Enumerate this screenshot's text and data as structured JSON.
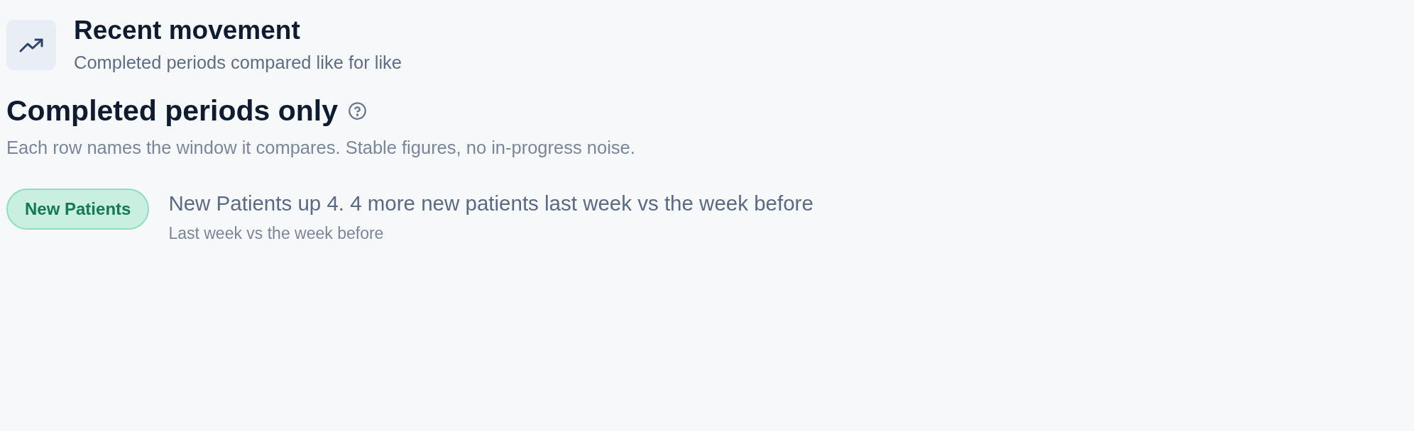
{
  "header": {
    "title": "Recent movement",
    "subtitle": "Completed periods compared like for like"
  },
  "section": {
    "title": "Completed periods only",
    "description": "Each row names the window it compares. Stable figures, no in-progress noise."
  },
  "rows": [
    {
      "tag": "New Patients",
      "summary": "New Patients up 4. 4 more new patients last week vs the week before",
      "period": "Last week vs the week before"
    }
  ]
}
